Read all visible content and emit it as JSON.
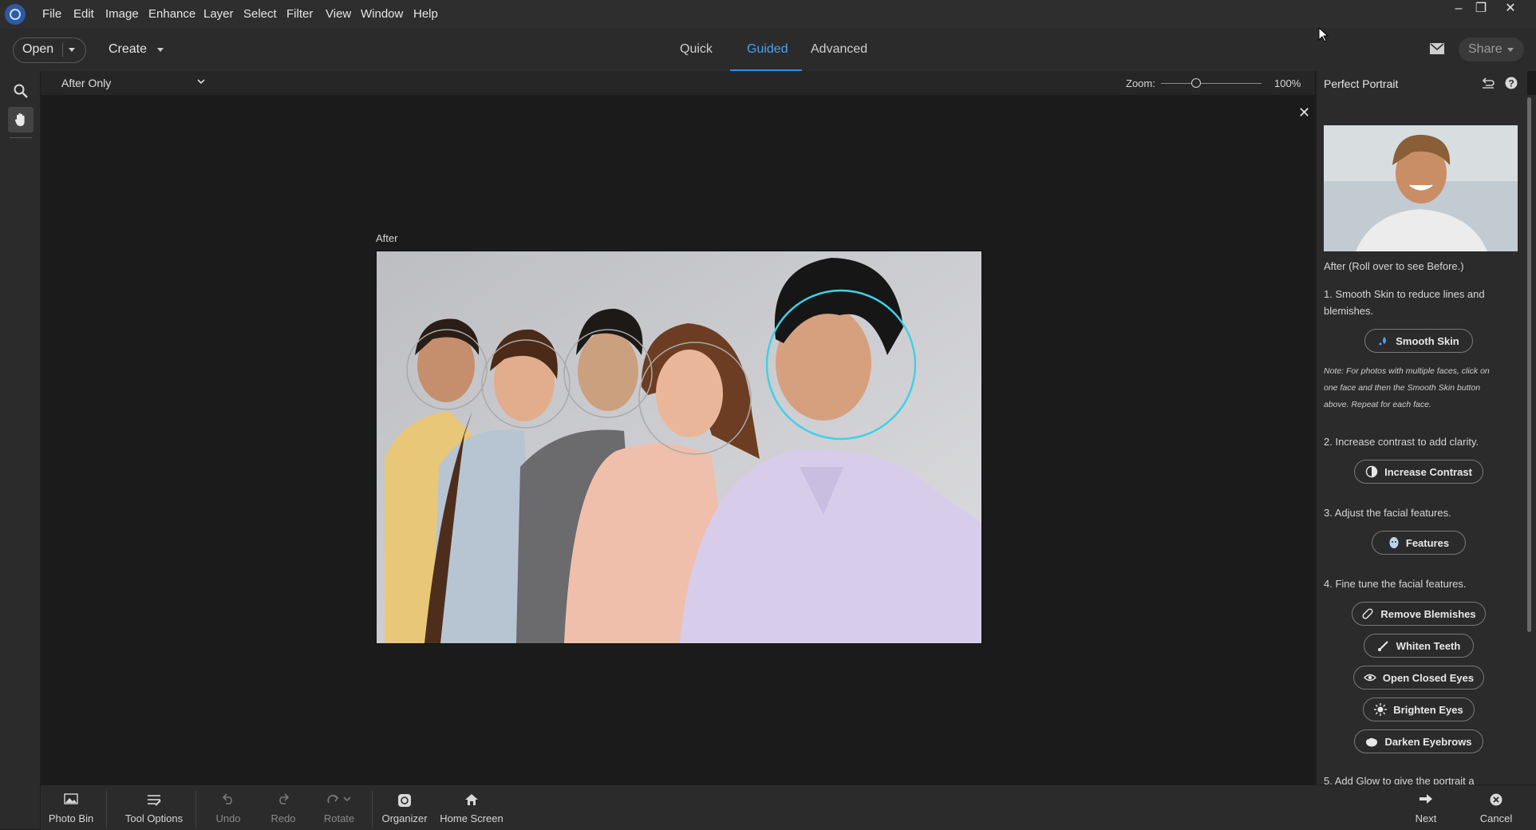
{
  "menu": [
    "File",
    "Edit",
    "Image",
    "Enhance",
    "Layer",
    "Select",
    "Filter",
    "View",
    "Window",
    "Help"
  ],
  "window_controls": {
    "minimize": "‒",
    "restore": "❐",
    "close": "✕"
  },
  "topbar": {
    "open_label": "Open",
    "create_label": "Create",
    "tabs": [
      "Quick",
      "Guided",
      "Advanced"
    ],
    "active_tab": "Guided",
    "share_label": "Share"
  },
  "options": {
    "view_mode": "After Only",
    "zoom_label": "Zoom:",
    "zoom_value": "100%",
    "zoom_fraction": 0.35
  },
  "canvas": {
    "image_label": "After",
    "close_icon": "✕"
  },
  "panel": {
    "title": "Perfect Portrait",
    "thumb_caption": "After (Roll over to see Before.)",
    "step1": "1. Smooth Skin to reduce lines and blemishes.",
    "smooth_skin": "Smooth Skin",
    "note": "Note: For photos with multiple faces, click on one face and then the Smooth Skin button above. Repeat for each face.",
    "step2": "2. Increase contrast to add clarity.",
    "increase_contrast": "Increase Contrast",
    "step3": "3. Adjust the facial features.",
    "features": "Features",
    "step4": "4. Fine tune the facial features.",
    "remove_blemishes": "Remove Blemishes",
    "whiten_teeth": "Whiten Teeth",
    "open_closed_eyes": "Open Closed Eyes",
    "brighten_eyes": "Brighten Eyes",
    "darken_eyebrows": "Darken Eyebrows",
    "step5": "5. Add Glow to give the portrait a"
  },
  "bottombar": {
    "photo_bin": "Photo Bin",
    "tool_options": "Tool Options",
    "undo": "Undo",
    "redo": "Redo",
    "rotate": "Rotate",
    "organizer": "Organizer",
    "home_screen": "Home Screen",
    "next": "Next",
    "cancel": "Cancel"
  },
  "colors": {
    "accent": "#2f8fe8",
    "selected_face_ring": "#41d0e6",
    "face_ring": "#a9a9a9"
  }
}
